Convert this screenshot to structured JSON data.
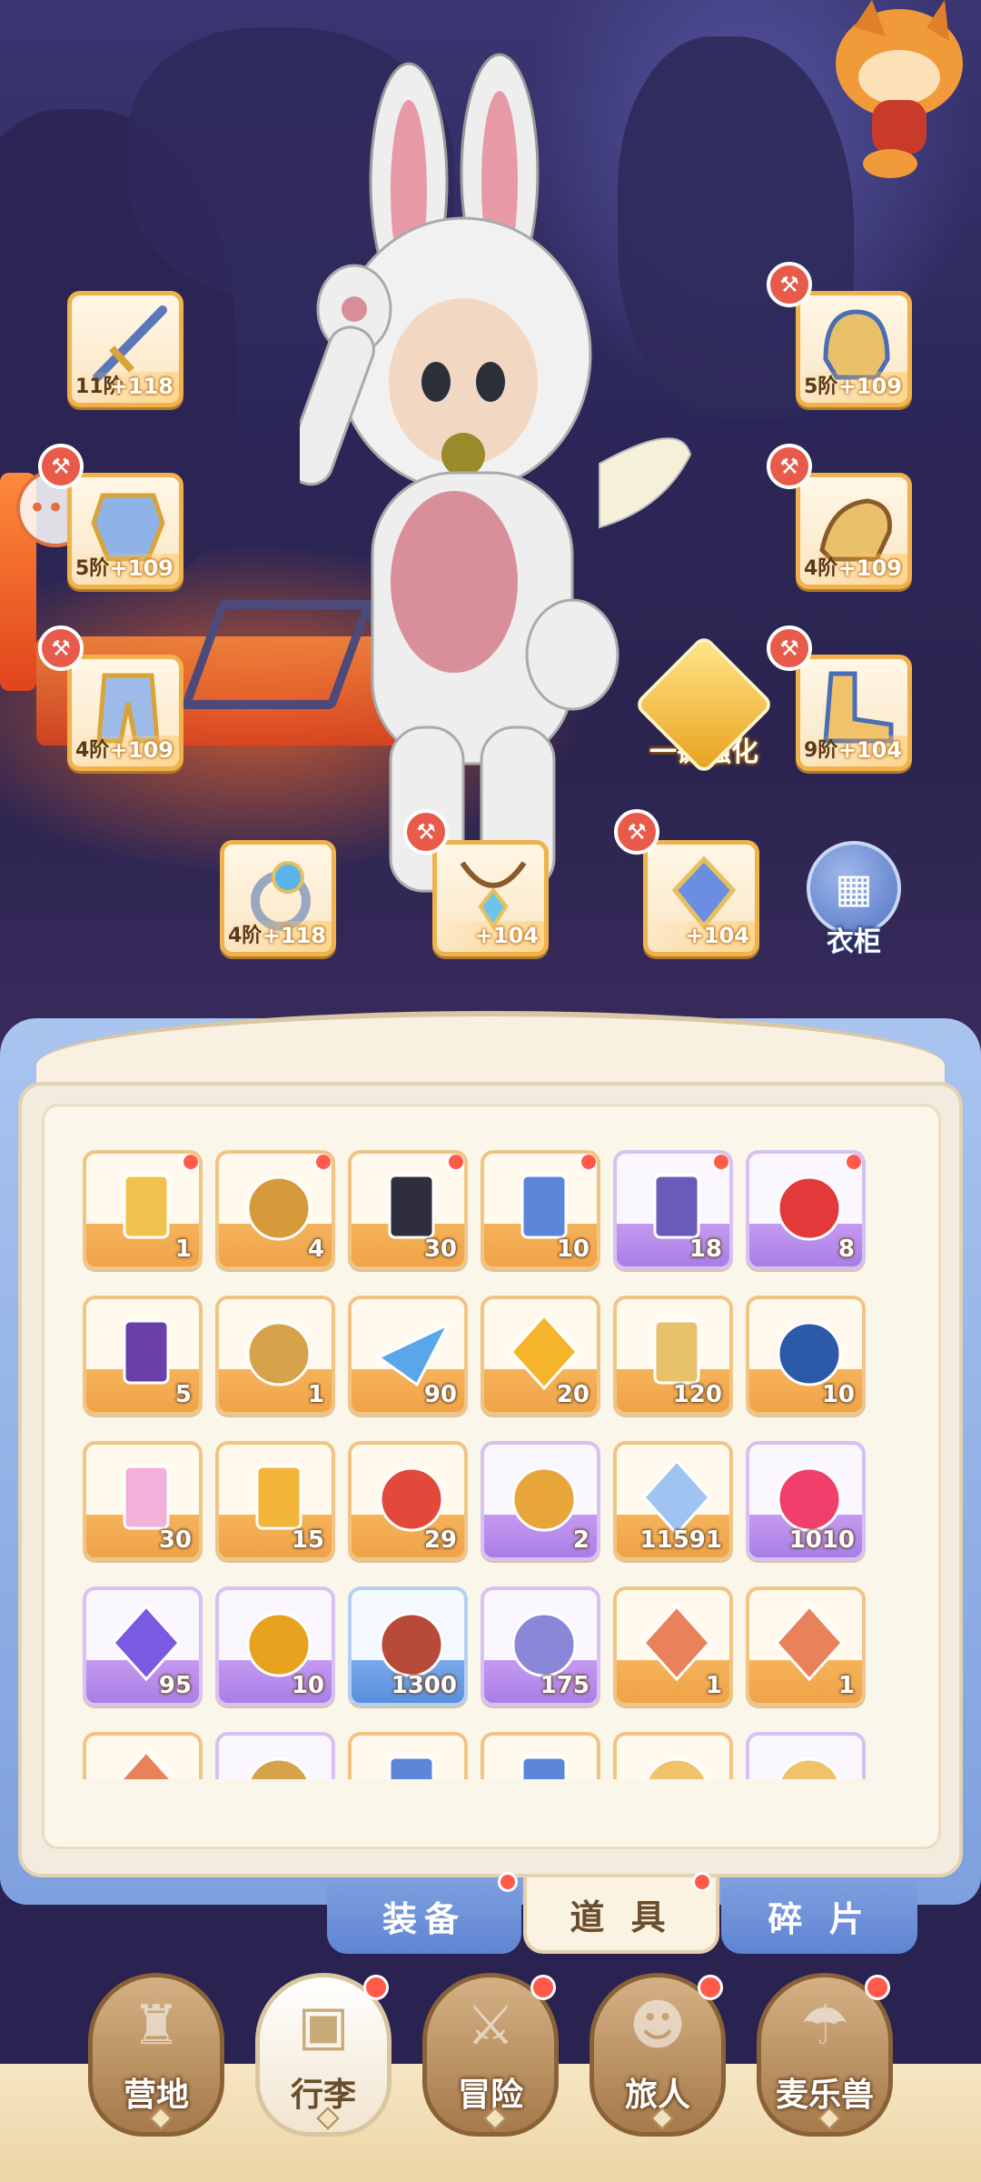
{
  "equipment": {
    "weapon": {
      "tier": "11阶",
      "level": "+118"
    },
    "helmet": {
      "tier": "5阶",
      "level": "+109"
    },
    "armor": {
      "tier": "5阶",
      "level": "+109"
    },
    "gloves": {
      "tier": "4阶",
      "level": "+109"
    },
    "pants": {
      "tier": "4阶",
      "level": "+109"
    },
    "boots": {
      "tier": "9阶",
      "level": "+104"
    },
    "ring": {
      "tier": "4阶",
      "level": "+118"
    },
    "necklace": {
      "tier": "",
      "level": "+104"
    },
    "charm": {
      "tier": "",
      "level": "+104"
    }
  },
  "one_click_enhance_label": "一键强化",
  "wardrobe_label": "衣柜",
  "items": [
    {
      "count": "1",
      "rarity": "orange",
      "icon": "golden-card-icon"
    },
    {
      "count": "4",
      "rarity": "orange",
      "icon": "bell-icon"
    },
    {
      "count": "30",
      "rarity": "orange",
      "icon": "dark-card-icon"
    },
    {
      "count": "10",
      "rarity": "orange",
      "icon": "blue-card-icon"
    },
    {
      "count": "18",
      "rarity": "purple",
      "icon": "moon-card-icon"
    },
    {
      "count": "8",
      "rarity": "purple",
      "icon": "apple-icon"
    },
    {
      "count": "5",
      "rarity": "orange",
      "icon": "purple-banner-icon"
    },
    {
      "count": "1",
      "rarity": "orange",
      "icon": "paw-stamp-icon"
    },
    {
      "count": "90",
      "rarity": "orange",
      "icon": "paper-plane-icon"
    },
    {
      "count": "20",
      "rarity": "orange",
      "icon": "gold-crystal-icon"
    },
    {
      "count": "120",
      "rarity": "orange",
      "icon": "harp-icon"
    },
    {
      "count": "10",
      "rarity": "orange",
      "icon": "orb-icon"
    },
    {
      "count": "30",
      "rarity": "orange",
      "icon": "paint-tube-icon"
    },
    {
      "count": "15",
      "rarity": "orange",
      "icon": "costume-card-icon"
    },
    {
      "count": "29",
      "rarity": "orange",
      "icon": "red-bell-icon"
    },
    {
      "count": "2",
      "rarity": "purple",
      "icon": "horseshoe-icon"
    },
    {
      "count": "11591",
      "rarity": "orange",
      "icon": "star-crystal-icon"
    },
    {
      "count": "1010",
      "rarity": "purple",
      "icon": "heart-icon"
    },
    {
      "count": "95",
      "rarity": "purple",
      "icon": "purple-crystal-icon"
    },
    {
      "count": "10",
      "rarity": "purple",
      "icon": "amber-egg-icon"
    },
    {
      "count": "1300",
      "rarity": "blue",
      "icon": "fur-pouch-icon"
    },
    {
      "count": "175",
      "rarity": "purple",
      "icon": "heart-coin-icon"
    },
    {
      "count": "1",
      "rarity": "orange",
      "icon": "ore-sword-icon"
    },
    {
      "count": "1",
      "rarity": "orange",
      "icon": "ore-armor-icon"
    },
    {
      "count": "",
      "rarity": "orange",
      "icon": "ore-icon"
    },
    {
      "count": "",
      "rarity": "purple",
      "icon": "key-icon"
    },
    {
      "count": "",
      "rarity": "orange",
      "icon": "card-icon"
    },
    {
      "count": "",
      "rarity": "orange",
      "icon": "card-icon"
    },
    {
      "count": "",
      "rarity": "orange",
      "icon": "cat-icon"
    },
    {
      "count": "",
      "rarity": "purple",
      "icon": "face-icon"
    }
  ],
  "subtabs": {
    "equipment": "装备",
    "items": "道 具",
    "fragments": "碎 片"
  },
  "nav": {
    "camp": "营地",
    "luggage": "行李",
    "adventure": "冒险",
    "traveler": "旅人",
    "mairebeast": "麦乐兽"
  },
  "colors": {
    "orange_rarity": "#f0a348",
    "purple_rarity": "#a97ee6",
    "blue_rarity": "#5a8fdd",
    "badge": "#ff5a4a"
  }
}
